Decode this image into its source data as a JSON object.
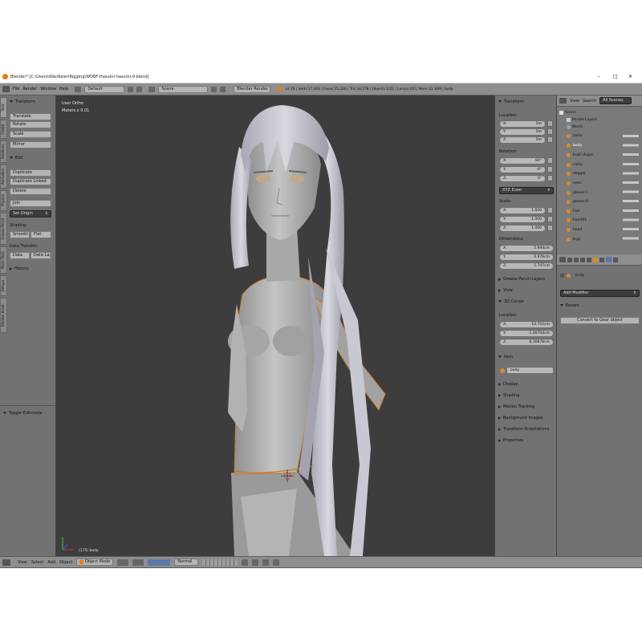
{
  "window": {
    "title": "Blender* [C:\\Users\\Wardialer\\Rigging\\WOBF-Hasumi-hasumi-9.blend]",
    "minimize": "–",
    "maximize": "□",
    "close": "✕"
  },
  "info_bar": {
    "menus": [
      "File",
      "Render",
      "Window",
      "Help"
    ],
    "layout": "Default",
    "scene": "Scene",
    "engine": "Blender Render",
    "stats": "v2.78 | Verts:17,926 | Faces:35,226 | Tris:34,578 | Objects:1/22 | Lamps:0/0 | Mem:33.30M | body"
  },
  "tool_shelf": {
    "tabs": [
      "Tools",
      "Create",
      "Relations",
      "Animation",
      "Physics",
      "Grease Pencil",
      "Mesh Tools",
      "Retopo",
      "Blender Asset"
    ],
    "transform_header": "Transform",
    "transform_buttons": [
      "Translate",
      "Rotate",
      "Scale",
      "Mirror"
    ],
    "edit_header": "Edit",
    "edit_buttons": [
      "Duplicate",
      "Duplicate Linked",
      "Delete",
      "Join"
    ],
    "set_origin": "Set Origin",
    "shading_label": "Shading:",
    "smooth": "Smooth",
    "flat": "Flat",
    "data_transfer_label": "Data Transfer:",
    "data": "Data",
    "data_layout": "Data Layo",
    "history_header": "History",
    "toggle_editmode": "Toggle Editmode"
  },
  "viewport": {
    "view_label": "User Ortho",
    "units_label": "Meters x 0.01",
    "object_label": "(175) body"
  },
  "view_header": {
    "menus": [
      "View",
      "Select",
      "Add",
      "Object"
    ],
    "mode": "Object Mode",
    "pivot": "Normal"
  },
  "n_panel": {
    "transform_header": "Transform",
    "location_label": "Location:",
    "location": [
      {
        "axis": "X:",
        "value": "0m"
      },
      {
        "axis": "Y:",
        "value": "0m"
      },
      {
        "axis": "Z:",
        "value": "0m"
      }
    ],
    "rotation_label": "Rotation:",
    "rotation": [
      {
        "axis": "X:",
        "value": "90°"
      },
      {
        "axis": "Y:",
        "value": "-0°"
      },
      {
        "axis": "Z:",
        "value": "0°"
      }
    ],
    "rotation_mode": "XYZ Euler",
    "scale_label": "Scale:",
    "scale": [
      {
        "axis": "X:",
        "value": "1.000"
      },
      {
        "axis": "Y:",
        "value": "1.000"
      },
      {
        "axis": "Z:",
        "value": "1.000"
      }
    ],
    "dimensions_label": "Dimensions:",
    "dimensions": [
      {
        "axis": "X:",
        "value": "5.994cm"
      },
      {
        "axis": "Y:",
        "value": "6.976cm"
      },
      {
        "axis": "Z:",
        "value": "5.747cm"
      }
    ],
    "grease_pencil": "Grease Pencil Layers",
    "view": "View",
    "cursor_header": "3D Cursor",
    "cursor_location_label": "Location:",
    "cursor": [
      {
        "axis": "X:",
        "value": "13.752cm"
      },
      {
        "axis": "Y:",
        "value": "-1.60704cm"
      },
      {
        "axis": "Z:",
        "value": "8.30978cm"
      }
    ],
    "item_header": "Item",
    "item_name": "body",
    "sections": [
      "Display",
      "Shading",
      "Motion Tracking",
      "Background Images",
      "Transform Orientations",
      "Properties"
    ]
  },
  "outliner": {
    "menus": [
      "View",
      "Search"
    ],
    "filter": "All Scenes",
    "scene": "Scene",
    "items": [
      "RenderLayers",
      "World",
      "lashs",
      "body",
      "bust shape",
      "collar",
      "dagger",
      "eyes",
      "gloves L",
      "gloves R",
      "hair",
      "hair001",
      "head",
      "legs"
    ]
  },
  "properties": {
    "object_name": "body",
    "add_modifier": "Add Modifier",
    "modifier_name": "Eevers",
    "convert_button": "Convert to Gear object"
  },
  "colors": {
    "viewport_bg": "#3d3d3d",
    "panel_bg": "#727272",
    "header_bg": "#8e8e8e",
    "accent_orange": "#d98a2b"
  }
}
